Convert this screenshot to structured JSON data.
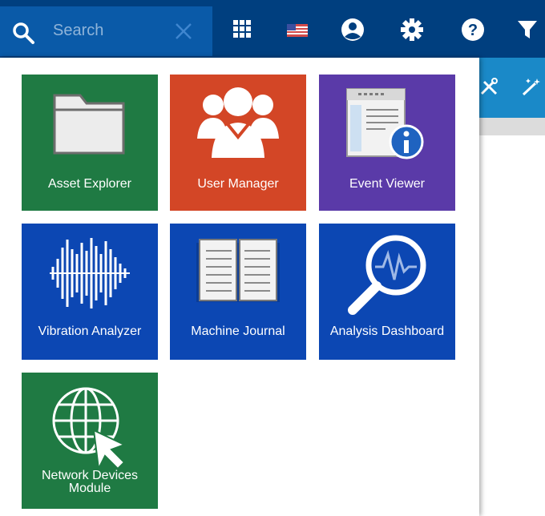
{
  "topbar": {
    "search_placeholder": "Search",
    "icons": [
      "search-icon",
      "clear-icon",
      "apps-grid-icon",
      "us-flag-icon",
      "user-account-icon",
      "settings-gear-icon",
      "help-icon",
      "filter-icon"
    ]
  },
  "colors": {
    "topbar": "#003f7f",
    "search_bg": "#0a5aa8",
    "tile_green": "#1f7a43",
    "tile_orange": "#d34626",
    "tile_purple": "#5a3aa8",
    "tile_blue": "#0c47b3",
    "accent_bar": "#1a89c8"
  },
  "apps": [
    {
      "label": "Asset Explorer",
      "icon": "folder-icon"
    },
    {
      "label": "User Manager",
      "icon": "users-group-icon"
    },
    {
      "label": "Event Viewer",
      "icon": "event-info-icon"
    },
    {
      "label": "Vibration Analyzer",
      "icon": "waveform-icon"
    },
    {
      "label": "Machine Journal",
      "icon": "open-book-icon"
    },
    {
      "label": "Analysis Dashboard",
      "icon": "magnifier-wave-icon"
    },
    {
      "label": "Network Devices Module",
      "line1": "Network Devices",
      "line2": "Module",
      "icon": "globe-cursor-icon"
    }
  ]
}
